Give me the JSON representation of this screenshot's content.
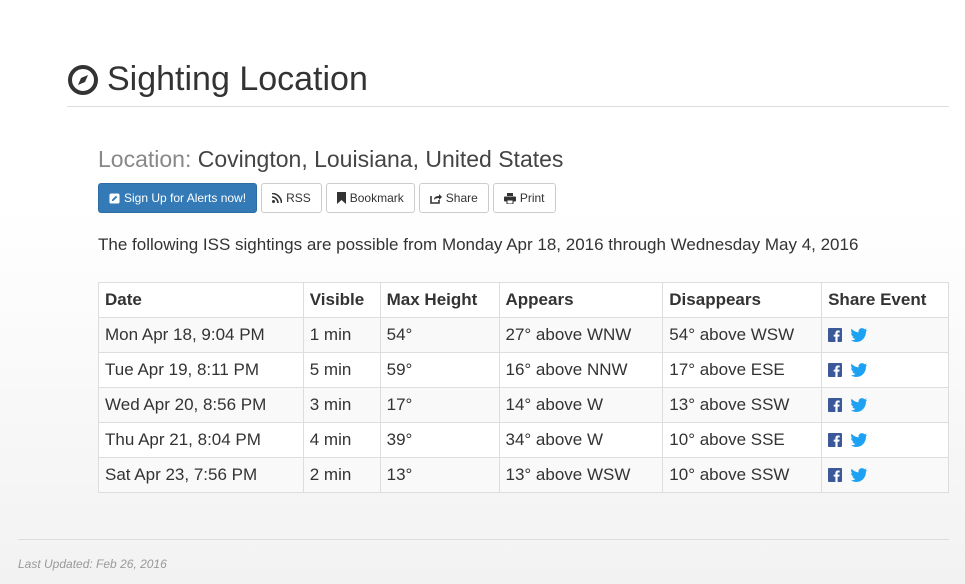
{
  "header": {
    "title": "Sighting Location"
  },
  "location": {
    "label": "Location:",
    "value": "Covington, Louisiana, United States"
  },
  "buttons": {
    "alerts": "Sign Up for Alerts now!",
    "rss": "RSS",
    "bookmark": "Bookmark",
    "share": "Share",
    "print": "Print"
  },
  "intro": "The following ISS sightings are possible from Monday Apr 18, 2016 through Wednesday May 4, 2016",
  "table": {
    "headers": [
      "Date",
      "Visible",
      "Max Height",
      "Appears",
      "Disappears",
      "Share Event"
    ],
    "rows": [
      [
        "Mon Apr 18, 9:04 PM",
        "1 min",
        "54°",
        "27° above WNW",
        "54° above WSW"
      ],
      [
        "Tue Apr 19, 8:11 PM",
        "5 min",
        "59°",
        "16° above NNW",
        "17° above ESE"
      ],
      [
        "Wed Apr 20, 8:56 PM",
        "3 min",
        "17°",
        "14° above W",
        "13° above SSW"
      ],
      [
        "Thu Apr 21, 8:04 PM",
        "4 min",
        "39°",
        "34° above W",
        "10° above SSE"
      ],
      [
        "Sat Apr 23, 7:56 PM",
        "2 min",
        "13°",
        "13° above WSW",
        "10° above SSW"
      ]
    ]
  },
  "footer": {
    "updated": "Last Updated: Feb 26, 2016"
  },
  "colors": {
    "primary": "#337ab7",
    "facebook": "#3b5998",
    "twitter": "#1da1f2"
  },
  "icons": [
    "compass-icon",
    "pencil-icon",
    "rss-icon",
    "bookmark-icon",
    "share-icon",
    "print-icon",
    "facebook-icon",
    "twitter-icon"
  ]
}
